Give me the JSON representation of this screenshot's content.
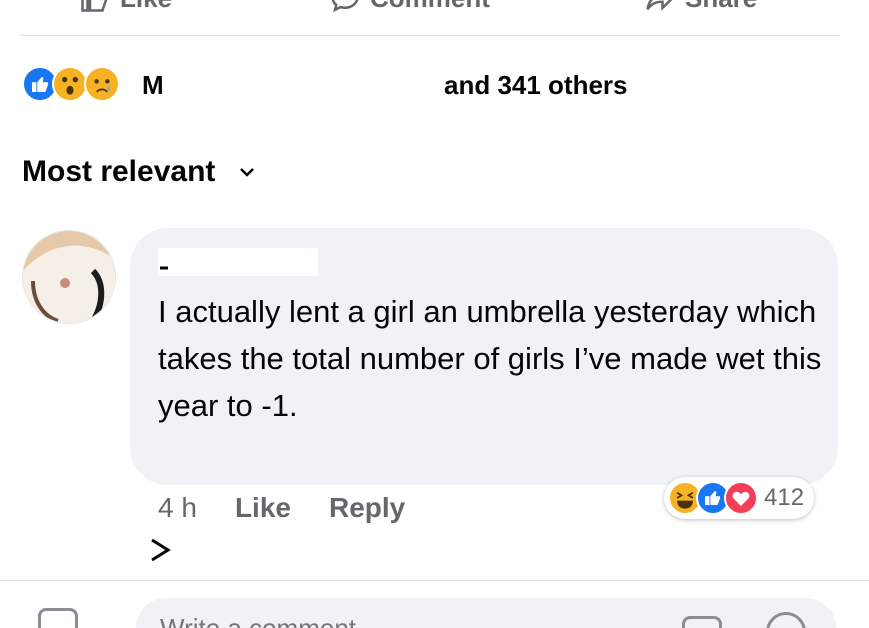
{
  "actions": {
    "like_label": "Like",
    "comment_label": "Comment",
    "share_label": "Share"
  },
  "reactions": {
    "icons": [
      "like-icon",
      "wow-icon",
      "sad-icon"
    ],
    "name_text": "M",
    "others_text": "and 341 others"
  },
  "sort": {
    "label": "Most relevant"
  },
  "comment": {
    "text": "I actually lent a girl an umbrella yesterday which takes the total number of girls I’ve made wet this year to -1.",
    "time": "4 h",
    "like_label": "Like",
    "reply_label": "Reply",
    "reaction_count": "412",
    "reaction_icons": [
      "haha-icon",
      "like-icon",
      "love-icon"
    ]
  },
  "composer": {
    "placeholder": "Write a comment..."
  },
  "colors": {
    "accent_blue": "#1877f2",
    "love_red": "#f33e58",
    "emoji_yellow": "#f7b125",
    "secondary_text": "#65676b",
    "bubble_bg": "#f0f2f5"
  }
}
